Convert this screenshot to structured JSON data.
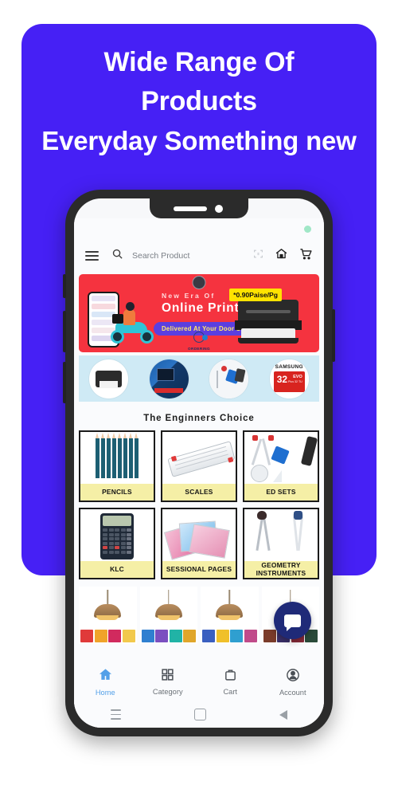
{
  "promo": {
    "line1": "Wide Range Of",
    "line2": "Products",
    "line3": "Everyday Something new",
    "bg_color": "#4620f5"
  },
  "app": {
    "topbar": {
      "menu_icon": "hamburger-icon",
      "search_icon": "search-icon",
      "search_placeholder": "Search Product",
      "scan_icon": "barcode-scan-icon",
      "home_icon": "home-icon",
      "cart_icon": "cart-icon",
      "status_dot": "online-indicator"
    },
    "banner": {
      "eyebrow": "New Era Of",
      "title": "Online Printing",
      "pill": "Delivered At Your Door Step",
      "price_badge": "*0.90Paise/Pg",
      "logo_text": "ORDERING",
      "bg_color": "#f5333f",
      "price_bg": "#ffe300"
    },
    "categories": [
      {
        "name": "printer",
        "label": "Printer"
      },
      {
        "name": "computer",
        "label": "Computers"
      },
      {
        "name": "instruments",
        "label": "Instruments"
      },
      {
        "name": "memory-card",
        "brand": "SAMSUNG",
        "capacity": "32",
        "series": "EVO",
        "sub": "Plus\n32 TU"
      }
    ],
    "section_title": "The Enginners Choice",
    "products": [
      {
        "label": "PENCILS",
        "art": "pencils"
      },
      {
        "label": "SCALES",
        "art": "scales"
      },
      {
        "label": "ED SETS",
        "art": "edsets"
      },
      {
        "label": "KLC",
        "art": "calculator"
      },
      {
        "label": "SESSIONAL PAGES",
        "art": "pages"
      },
      {
        "label": "GEOMETRY INSTRUMENTS",
        "art": "geometry"
      }
    ],
    "lamp_row": [
      {
        "name": "lamp-product-1"
      },
      {
        "name": "lamp-product-2"
      },
      {
        "name": "lamp-product-3"
      },
      {
        "name": "lamp-product-4"
      }
    ],
    "fab": {
      "icon": "chat-bubble-icon",
      "color": "#1f2a78"
    },
    "bottom_nav": [
      {
        "label": "Home",
        "icon": "home-icon",
        "active": true
      },
      {
        "label": "Category",
        "icon": "grid-icon",
        "active": false
      },
      {
        "label": "Cart",
        "icon": "bag-icon",
        "active": false
      },
      {
        "label": "Account",
        "icon": "person-icon",
        "active": false
      }
    ],
    "system_nav": [
      {
        "name": "recents-button"
      },
      {
        "name": "home-button"
      },
      {
        "name": "back-button"
      }
    ]
  }
}
